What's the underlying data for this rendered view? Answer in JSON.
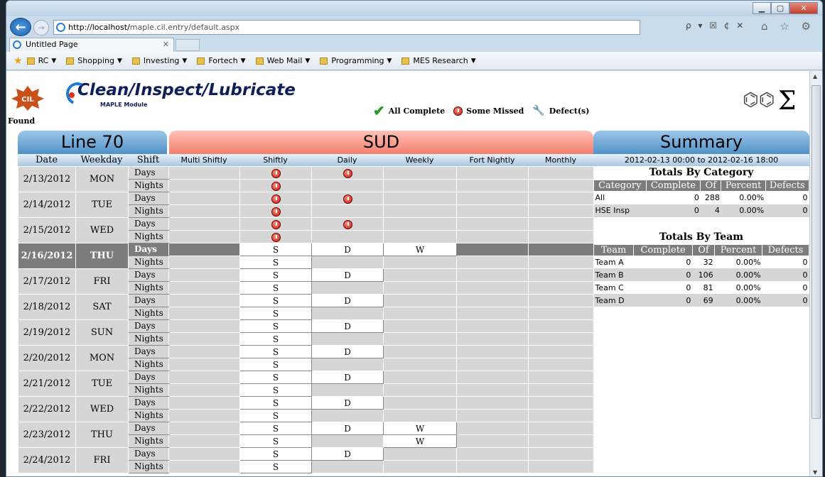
{
  "browser": {
    "url_host": "http://localhost/",
    "url_path": "maple.cil.entry/default.aspx",
    "tab_title": "Untitled Page",
    "addr_controls": "ρ ▾ ☒ ¢ ✕",
    "tool_icons": "⌂ ☆ ⚙"
  },
  "favorites": [
    {
      "label": "RC"
    },
    {
      "label": "Shopping"
    },
    {
      "label": "Investing"
    },
    {
      "label": "Fortech"
    },
    {
      "label": "Web Mail"
    },
    {
      "label": "Programming"
    },
    {
      "label": "MES Research"
    }
  ],
  "app": {
    "title": "Clean/Inspect/Lubricate",
    "subtitle": "MAPLE Module",
    "logo_text": "CIL",
    "found_label": "Found"
  },
  "legend": {
    "all_complete": "All Complete",
    "some_missed": "Some Missed",
    "defects": "Defect(s)"
  },
  "headers": {
    "line": "Line 70",
    "sud": "SUD",
    "summary": "Summary"
  },
  "columns": {
    "date": "Date",
    "weekday": "Weekday",
    "shift": "Shift",
    "multi": "Multi Shiftly",
    "shiftly": "Shiftly",
    "daily": "Daily",
    "weekly": "Weekly",
    "fortnightly": "Fort Nightly",
    "monthly": "Monthly"
  },
  "summary_range": "2012-02-13 00:00 to 2012-02-16 18:00",
  "schedule": [
    {
      "date": "2/13/2012",
      "weekday": "MON",
      "days": [
        "",
        "m",
        "m",
        "",
        "",
        ""
      ],
      "nights": [
        "",
        "m",
        "",
        "",
        "",
        ""
      ]
    },
    {
      "date": "2/14/2012",
      "weekday": "TUE",
      "days": [
        "",
        "m",
        "m",
        "",
        "",
        ""
      ],
      "nights": [
        "",
        "m",
        "",
        "",
        "",
        ""
      ]
    },
    {
      "date": "2/15/2012",
      "weekday": "WED",
      "days": [
        "",
        "m",
        "m",
        "",
        "",
        ""
      ],
      "nights": [
        "",
        "m",
        "",
        "",
        "",
        ""
      ]
    },
    {
      "date": "2/16/2012",
      "weekday": "THU",
      "selected": true,
      "days": [
        "",
        "S",
        "D",
        "W",
        "",
        ""
      ],
      "nights": [
        "",
        "S",
        "",
        "",
        "",
        ""
      ]
    },
    {
      "date": "2/17/2012",
      "weekday": "FRI",
      "days": [
        "",
        "S",
        "D",
        "",
        "",
        ""
      ],
      "nights": [
        "",
        "S",
        "",
        "",
        "",
        ""
      ]
    },
    {
      "date": "2/18/2012",
      "weekday": "SAT",
      "days": [
        "",
        "S",
        "D",
        "",
        "",
        ""
      ],
      "nights": [
        "",
        "S",
        "",
        "",
        "",
        ""
      ]
    },
    {
      "date": "2/19/2012",
      "weekday": "SUN",
      "days": [
        "",
        "S",
        "D",
        "",
        "",
        ""
      ],
      "nights": [
        "",
        "S",
        "",
        "",
        "",
        ""
      ]
    },
    {
      "date": "2/20/2012",
      "weekday": "MON",
      "days": [
        "",
        "S",
        "D",
        "",
        "",
        ""
      ],
      "nights": [
        "",
        "S",
        "",
        "",
        "",
        ""
      ]
    },
    {
      "date": "2/21/2012",
      "weekday": "TUE",
      "days": [
        "",
        "S",
        "D",
        "",
        "",
        ""
      ],
      "nights": [
        "",
        "S",
        "",
        "",
        "",
        ""
      ]
    },
    {
      "date": "2/22/2012",
      "weekday": "WED",
      "days": [
        "",
        "S",
        "D",
        "",
        "",
        ""
      ],
      "nights": [
        "",
        "S",
        "",
        "",
        "",
        ""
      ]
    },
    {
      "date": "2/23/2012",
      "weekday": "THU",
      "days": [
        "",
        "S",
        "D",
        "W",
        "",
        ""
      ],
      "nights": [
        "",
        "S",
        "",
        "W",
        "",
        ""
      ]
    },
    {
      "date": "2/24/2012",
      "weekday": "FRI",
      "days": [
        "",
        "S",
        "D",
        "",
        "",
        ""
      ],
      "nights": [
        "",
        "S",
        "",
        "",
        "",
        ""
      ]
    }
  ],
  "shift_labels": {
    "days": "Days",
    "nights": "Nights"
  },
  "totals_by_category": {
    "title": "Totals By Category",
    "headers": [
      "Category",
      "Complete",
      "Of",
      "Percent",
      "Defects"
    ],
    "rows": [
      [
        "All",
        "0",
        "288",
        "0.00%",
        "0"
      ],
      [
        "HSE Insp",
        "0",
        "4",
        "0.00%",
        "0"
      ]
    ]
  },
  "totals_by_team": {
    "title": "Totals By Team",
    "headers": [
      "Team",
      "Complete",
      "Of",
      "Percent",
      "Defects"
    ],
    "rows": [
      [
        "Team A",
        "0",
        "32",
        "0.00%",
        "0"
      ],
      [
        "Team B",
        "0",
        "106",
        "0.00%",
        "0"
      ],
      [
        "Team C",
        "0",
        "81",
        "0.00%",
        "0"
      ],
      [
        "Team D",
        "0",
        "69",
        "0.00%",
        "0"
      ]
    ]
  }
}
